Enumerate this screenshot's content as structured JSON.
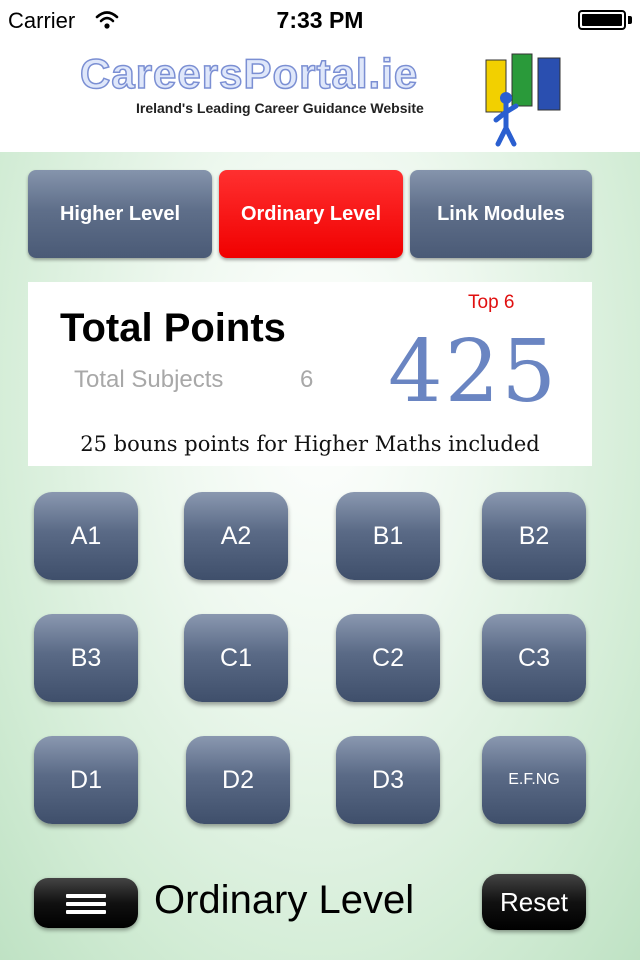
{
  "status_bar": {
    "carrier": "Carrier",
    "time": "7:33 PM"
  },
  "header": {
    "logo_text": "CareersPortal.ie",
    "tagline": "Ireland's Leading Career Guidance Website"
  },
  "tabs": [
    {
      "label": "Higher Level",
      "active": false
    },
    {
      "label": "Ordinary Level",
      "active": true
    },
    {
      "label": "Link Modules",
      "active": false
    }
  ],
  "points": {
    "title": "Total Points",
    "subjects_label": "Total Subjects",
    "subjects_count": "6",
    "top_label": "Top 6",
    "total": "425",
    "bonus_note": "25 bouns points for Higher Maths included"
  },
  "grades": [
    "A1",
    "A2",
    "B1",
    "B2",
    "B3",
    "C1",
    "C2",
    "C3",
    "D1",
    "D2",
    "D3",
    "E.F.NG"
  ],
  "footer": {
    "level_label": "Ordinary Level",
    "reset_label": "Reset"
  },
  "colors": {
    "active_tab": "#ff0000",
    "tab": "#5f6f8a",
    "points": "#6a85c2",
    "top_label": "#e01010"
  }
}
